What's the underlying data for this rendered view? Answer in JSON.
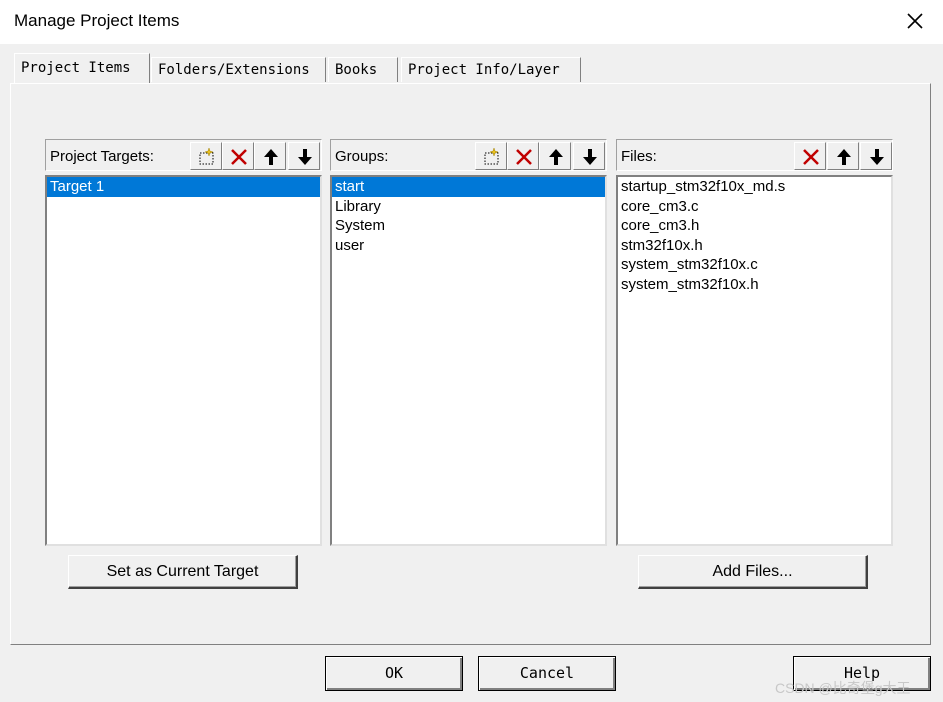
{
  "window": {
    "title": "Manage Project Items",
    "close_icon": "close-icon"
  },
  "tabs": [
    {
      "label": "Project Items",
      "active": true
    },
    {
      "label": "Folders/Extensions",
      "active": false
    },
    {
      "label": "Books",
      "active": false
    },
    {
      "label": "Project Info/Layer",
      "active": false
    }
  ],
  "targets": {
    "label": "Project Targets:",
    "items": [
      "Target 1"
    ],
    "selected": "Target 1",
    "tools": [
      "new-icon",
      "delete-icon",
      "move-up-icon",
      "move-down-icon"
    ]
  },
  "groups": {
    "label": "Groups:",
    "items": [
      "start",
      "Library",
      "System",
      "user"
    ],
    "selected": "start",
    "tools": [
      "new-icon",
      "delete-icon",
      "move-up-icon",
      "move-down-icon"
    ]
  },
  "files": {
    "label": "Files:",
    "items": [
      "startup_stm32f10x_md.s",
      "core_cm3.c",
      "core_cm3.h",
      "stm32f10x.h",
      "system_stm32f10x.c",
      "system_stm32f10x.h"
    ],
    "tools": [
      "delete-icon",
      "move-up-icon",
      "move-down-icon"
    ]
  },
  "buttons": {
    "set_current_target": "Set as Current Target",
    "add_files": "Add Files...",
    "ok": "OK",
    "cancel": "Cancel",
    "help": "Help"
  },
  "colors": {
    "selection": "#0078d7",
    "delete_x": "#c00000"
  },
  "watermark": "CSDN @比奇堡g大王"
}
